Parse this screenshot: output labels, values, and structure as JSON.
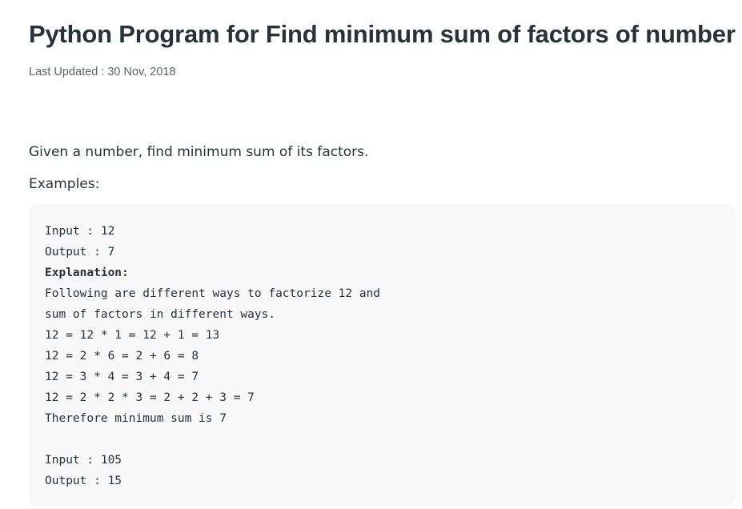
{
  "article": {
    "title": "Python Program for Find minimum sum of factors of number",
    "last_updated": "Last Updated : 30 Nov, 2018",
    "lead": "Given a number, find minimum sum of its factors.",
    "examples_label": "Examples:"
  },
  "code_block": {
    "lines": [
      "Input : 12",
      "Output : 7",
      "Explanation:",
      "Following are different ways to factorize 12 and",
      "sum of factors in different ways.",
      "12 = 12 * 1 = 12 + 1 = 13",
      "12 = 2 * 6 = 2 + 6 = 8",
      "12 = 3 * 4 = 3 + 4 = 7",
      "12 = 2 * 2 * 3 = 2 + 2 + 3 = 7",
      "Therefore minimum sum is 7",
      "",
      "Input : 105",
      "Output : 15"
    ]
  }
}
